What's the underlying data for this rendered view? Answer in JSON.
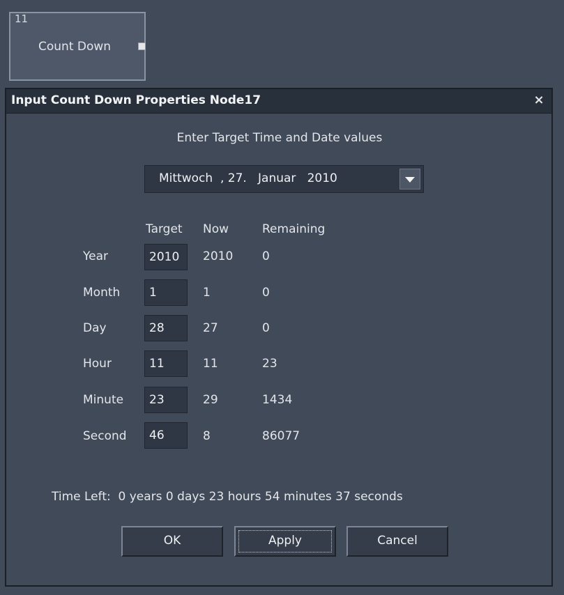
{
  "node": {
    "id": "11",
    "label": "Count Down"
  },
  "dialog": {
    "title": "Input Count Down Properties Node17",
    "close": "×",
    "heading": "Enter Target Time and Date values",
    "date_select": {
      "value": "Mittwoch  , 27.   Januar   2010"
    },
    "columns": {
      "target": "Target",
      "now": "Now",
      "remaining": "Remaining"
    },
    "rows": [
      {
        "label": "Year",
        "target": "2010",
        "now": "2010",
        "remaining": "0"
      },
      {
        "label": "Month",
        "target": "1",
        "now": "1",
        "remaining": "0"
      },
      {
        "label": "Day",
        "target": "28",
        "now": "27",
        "remaining": "0"
      },
      {
        "label": "Hour",
        "target": "11",
        "now": "11",
        "remaining": "23"
      },
      {
        "label": "Minute",
        "target": "23",
        "now": "29",
        "remaining": "1434"
      },
      {
        "label": "Second",
        "target": "46",
        "now": "8",
        "remaining": "86077"
      }
    ],
    "time_left": "Time Left:  0 years 0 days 23 hours 54 minutes 37 seconds",
    "buttons": {
      "ok": "OK",
      "apply": "Apply",
      "cancel": "Cancel"
    }
  }
}
